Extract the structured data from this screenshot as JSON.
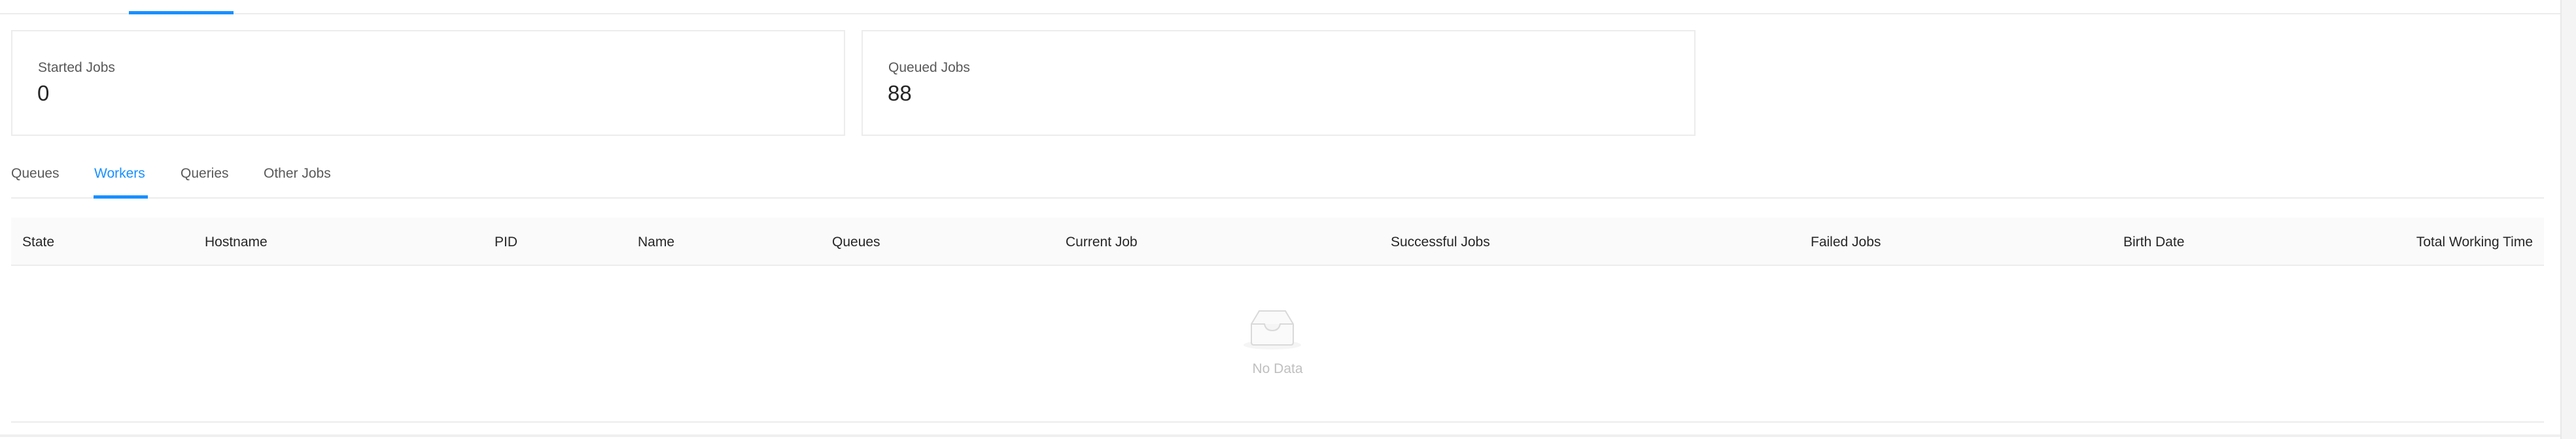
{
  "cards": {
    "started": {
      "label": "Started Jobs",
      "value": "0"
    },
    "queued": {
      "label": "Queued Jobs",
      "value": "88"
    }
  },
  "tabs": [
    {
      "label": "Queues",
      "active": false
    },
    {
      "label": "Workers",
      "active": true
    },
    {
      "label": "Queries",
      "active": false
    },
    {
      "label": "Other Jobs",
      "active": false
    }
  ],
  "table": {
    "columns": [
      "State",
      "Hostname",
      "PID",
      "Name",
      "Queues",
      "Current Job",
      "Successful Jobs",
      "Failed Jobs",
      "Birth Date",
      "Total Working Time"
    ],
    "rows": [],
    "empty_text": "No Data"
  },
  "icons": {
    "empty": "empty-inbox-icon"
  },
  "colors": {
    "accent": "#1890ff",
    "muted": "#bfbfbf",
    "border": "#ececec"
  }
}
